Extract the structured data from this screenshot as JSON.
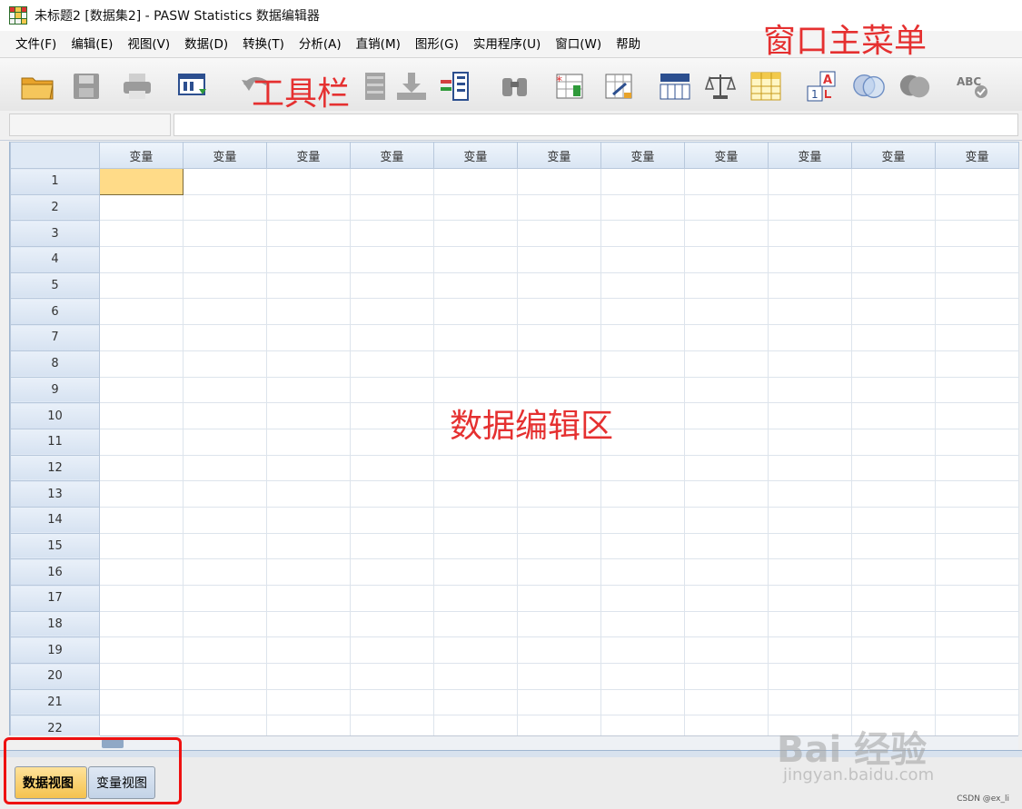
{
  "window": {
    "title": "未标题2 [数据集2] - PASW Statistics 数据编辑器"
  },
  "menu": [
    {
      "id": "file",
      "label": "文件(F)"
    },
    {
      "id": "edit",
      "label": "编辑(E)"
    },
    {
      "id": "view",
      "label": "视图(V)"
    },
    {
      "id": "data",
      "label": "数据(D)"
    },
    {
      "id": "transform",
      "label": "转换(T)"
    },
    {
      "id": "analyze",
      "label": "分析(A)"
    },
    {
      "id": "marketing",
      "label": "直销(M)"
    },
    {
      "id": "graphs",
      "label": "图形(G)"
    },
    {
      "id": "utilities",
      "label": "实用程序(U)"
    },
    {
      "id": "window",
      "label": "窗口(W)"
    },
    {
      "id": "help",
      "label": "帮助"
    }
  ],
  "toolbar": {
    "icons": [
      "open-folder-icon",
      "save-icon",
      "print-icon",
      "dialog-recall-icon",
      "undo-icon",
      "goto-case-icon",
      "goto-variable-icon",
      "variables-icon",
      "find-icon",
      "insert-cases-icon",
      "insert-variable-icon",
      "split-file-icon",
      "weight-cases-icon",
      "select-cases-icon",
      "value-labels-icon",
      "use-sets-icon",
      "show-all-variables-icon",
      "spell-check-icon"
    ]
  },
  "grid": {
    "column_header": "变量",
    "column_count": 11,
    "rows": [
      "1",
      "2",
      "3",
      "4",
      "5",
      "6",
      "7",
      "8",
      "9",
      "10",
      "11",
      "12",
      "13",
      "14",
      "15",
      "16",
      "17",
      "18",
      "19",
      "20",
      "21",
      "22"
    ],
    "active_cell": {
      "row": "1",
      "column": 1
    }
  },
  "annotations": {
    "menu": "窗口主菜单",
    "toolbar": "工具栏",
    "editor": "数据编辑区"
  },
  "tabs": {
    "data_view": "数据视图",
    "variable_view": "变量视图"
  },
  "watermark": {
    "brand": "Bai 经验",
    "url": "jingyan.baidu.com"
  },
  "credit": "CSDN @ex_li",
  "colors": {
    "active_cell": "#ffdb88",
    "annotation": "#e53030",
    "header": "#dfe9f5",
    "data_tab": "#f5c24e"
  }
}
